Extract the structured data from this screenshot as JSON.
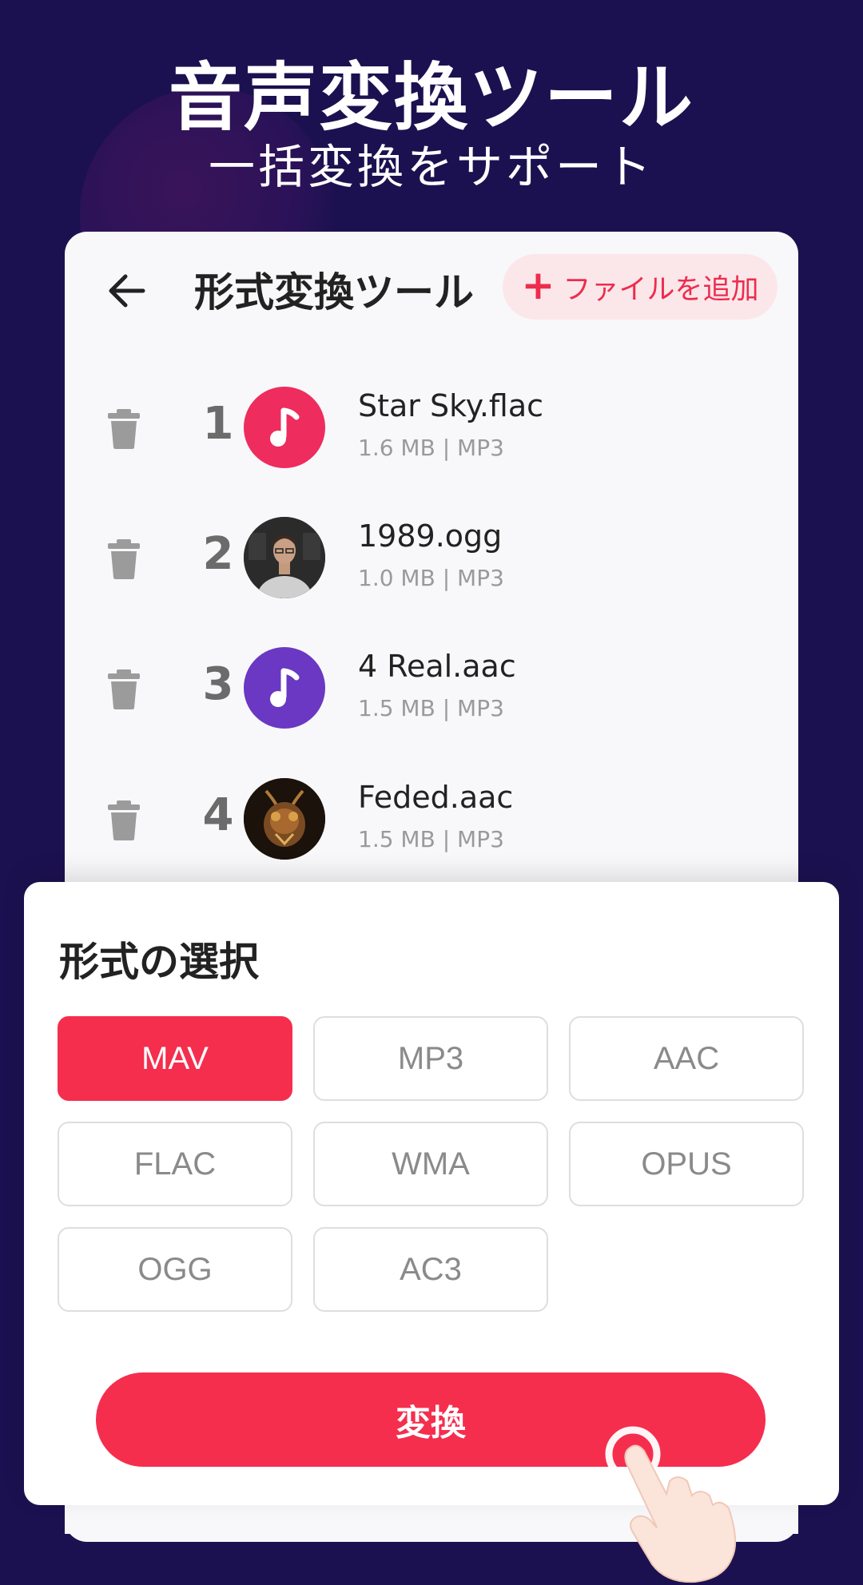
{
  "promo": {
    "title": "音声変換ツール",
    "subtitle": "一括変換をサポート"
  },
  "header": {
    "back_icon": "arrow-left-icon",
    "title": "形式変換ツール",
    "add_file_label": "ファイルを追加"
  },
  "files": [
    {
      "index": "1",
      "name": "Star Sky.flac",
      "meta": "1.6 MB | MP3",
      "thumb": "music-note-icon",
      "thumb_color": "#ee2c5e"
    },
    {
      "index": "2",
      "name": "1989.ogg",
      "meta": "1.0 MB | MP3",
      "thumb": "portrait-photo",
      "thumb_color": "#2a2a2a"
    },
    {
      "index": "3",
      "name": "4 Real.aac",
      "meta": "1.5 MB | MP3",
      "thumb": "music-note-icon",
      "thumb_color": "#6a38c2"
    },
    {
      "index": "4",
      "name": "Feded.aac",
      "meta": "1.5 MB | MP3",
      "thumb": "insect-photo",
      "thumb_color": "#3a2a1a"
    }
  ],
  "format_sheet": {
    "title": "形式の選択",
    "selected": "MAV",
    "options": [
      "MAV",
      "MP3",
      "AAC",
      "FLAC",
      "WMA",
      "OPUS",
      "OGG",
      "AC3"
    ],
    "convert_label": "変換"
  },
  "colors": {
    "background": "#1c1150",
    "accent": "#f52e4e",
    "accent_soft": "#fbe7ea"
  }
}
